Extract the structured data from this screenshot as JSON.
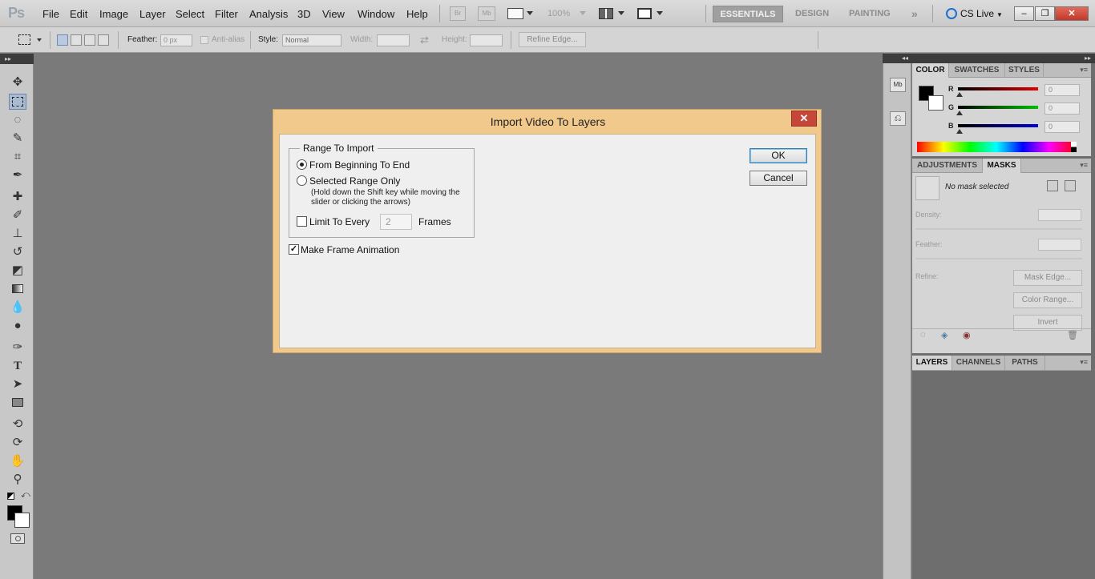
{
  "app": {
    "logo": "Ps"
  },
  "menu": [
    "File",
    "Edit",
    "Image",
    "Layer",
    "Select",
    "Filter",
    "Analysis",
    "3D",
    "View",
    "Window",
    "Help"
  ],
  "menubar_controls": {
    "bridge": "Br",
    "minibridge": "Mb",
    "zoom": "100%"
  },
  "workspaces": {
    "essentials": "ESSENTIALS",
    "design": "DESIGN",
    "painting": "PAINTING",
    "more": "»"
  },
  "cslive": "CS Live",
  "window_controls": {
    "minimize": "–",
    "restore": "❐",
    "close": "✕"
  },
  "options": {
    "feather_label": "Feather:",
    "feather_value": "0 px",
    "antialias_label": "Anti-alias",
    "style_label": "Style:",
    "style_value": "Normal",
    "width_label": "Width:",
    "height_label": "Height:",
    "refine_edge": "Refine Edge..."
  },
  "panels": {
    "color": {
      "tabs": [
        "COLOR",
        "SWATCHES",
        "STYLES"
      ],
      "channels": [
        {
          "label": "R",
          "value": "0",
          "color": "#e00000"
        },
        {
          "label": "G",
          "value": "0",
          "color": "#00c000"
        },
        {
          "label": "B",
          "value": "0",
          "color": "#0000d0"
        }
      ]
    },
    "adjustments": {
      "tabs": [
        "ADJUSTMENTS",
        "MASKS"
      ],
      "mask_status": "No mask selected",
      "density_label": "Density:",
      "feather_label": "Feather:",
      "refine_label": "Refine:",
      "mask_edge": "Mask Edge...",
      "color_range": "Color Range...",
      "invert": "Invert"
    },
    "layers": {
      "tabs": [
        "LAYERS",
        "CHANNELS",
        "PATHS"
      ]
    }
  },
  "dialog": {
    "title": "Import Video To Layers",
    "close": "✕",
    "range_group": "Range To Import",
    "option_all": "From Beginning To End",
    "option_selected": "Selected Range Only",
    "selected_note": "(Hold down the Shift key while moving the slider or clicking the arrows)",
    "limit_label": "Limit To Every",
    "limit_value": "2",
    "frames_label": "Frames",
    "make_animation": "Make Frame Animation",
    "ok": "OK",
    "cancel": "Cancel",
    "state": {
      "range": "from_beginning",
      "limit_checked": false,
      "make_animation_checked": true
    }
  }
}
